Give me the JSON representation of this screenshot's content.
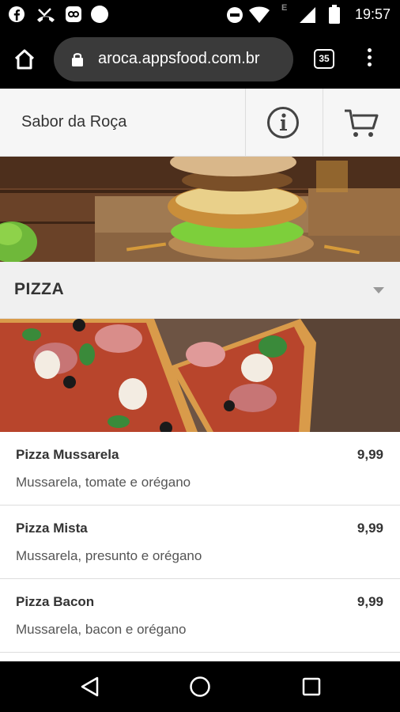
{
  "status_bar": {
    "time": "19:57",
    "icons": [
      "facebook-icon",
      "missed-call-icon",
      "app-notification-icon",
      "circle-icon",
      "do-not-disturb-icon",
      "wifi-icon",
      "edge-signal-icon",
      "cellular-signal-icon",
      "battery-icon"
    ],
    "network_label": "E"
  },
  "browser": {
    "url": "aroca.appsfood.com.br",
    "tab_count": "35"
  },
  "app_header": {
    "title": "Sabor da Roça"
  },
  "category": {
    "title": "PIZZA"
  },
  "menu_items": [
    {
      "name": "Pizza Mussarela",
      "price": "9,99",
      "description": "Mussarela, tomate e orégano"
    },
    {
      "name": "Pizza Mista",
      "price": "9,99",
      "description": "Mussarela, presunto e orégano"
    },
    {
      "name": "Pizza Bacon",
      "price": "9,99",
      "description": "Mussarela, bacon e orégano"
    }
  ],
  "colors": {
    "header_bg": "#f6f6f6",
    "category_bg": "#f0f0f0",
    "text_dark": "#333333"
  }
}
